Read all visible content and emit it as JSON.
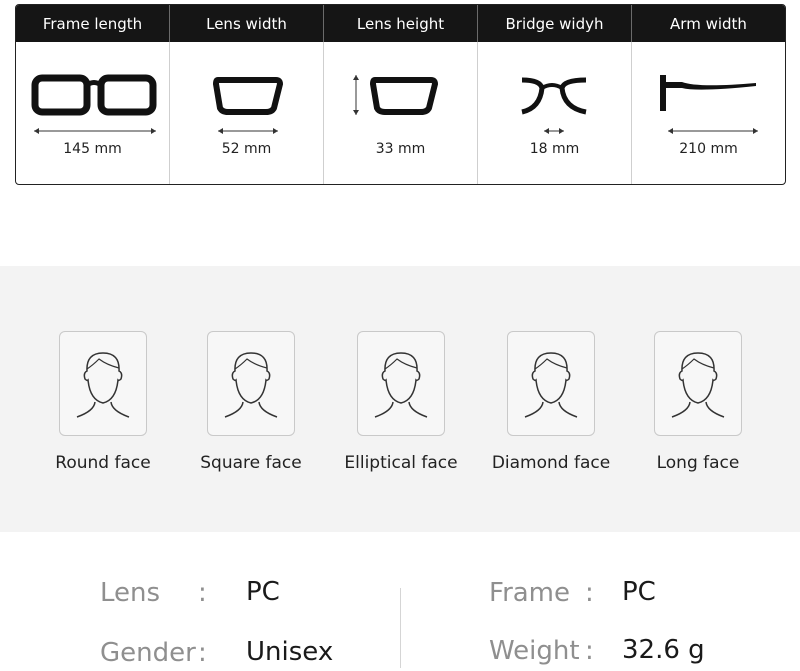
{
  "measurements": [
    {
      "label": "Frame length",
      "value": "145 mm",
      "icon": "full-frame-icon"
    },
    {
      "label": "Lens width",
      "value": "52 mm",
      "icon": "single-lens-icon"
    },
    {
      "label": "Lens height",
      "value": "33 mm",
      "icon": "lens-height-icon"
    },
    {
      "label": "Bridge widyh",
      "value": "18 mm",
      "icon": "bridge-icon"
    },
    {
      "label": "Arm width",
      "value": "210 mm",
      "icon": "temple-arm-icon"
    }
  ],
  "faces": [
    {
      "label": "Round face",
      "icon": "face-outline-icon"
    },
    {
      "label": "Square face",
      "icon": "face-outline-icon"
    },
    {
      "label": "Elliptical face",
      "icon": "face-outline-icon"
    },
    {
      "label": "Diamond face",
      "icon": "face-outline-icon"
    },
    {
      "label": "Long face",
      "icon": "face-outline-icon"
    }
  ],
  "specs": {
    "lens": {
      "key": "Lens",
      "colon": ":",
      "value": "PC"
    },
    "gender": {
      "key": "Gender",
      "colon": ":",
      "value": "Unisex"
    },
    "frame": {
      "key": "Frame",
      "colon": ":",
      "value": "PC"
    },
    "weight": {
      "key": "Weight",
      "colon": ":",
      "value": "32.6 g"
    }
  },
  "colors": {
    "header_bg": "#151515",
    "band_bg": "#f3f3f3",
    "label_gray": "#8f8f8f"
  }
}
